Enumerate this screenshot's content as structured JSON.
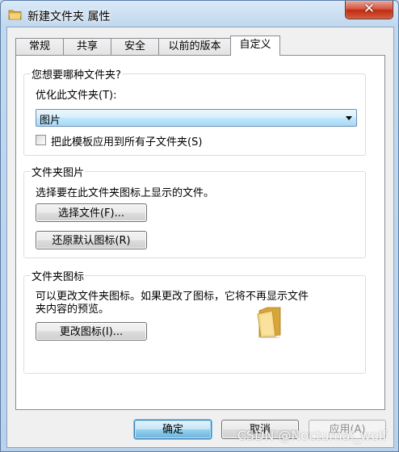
{
  "window": {
    "title": "新建文件夹 属性",
    "close_symbol": "✕"
  },
  "tabs": [
    {
      "label": "常规",
      "active": false
    },
    {
      "label": "共享",
      "active": false
    },
    {
      "label": "安全",
      "active": false
    },
    {
      "label": "以前的版本",
      "active": false
    },
    {
      "label": "自定义",
      "active": true
    }
  ],
  "folder_type_group": {
    "title": "您想要哪种文件夹?",
    "optimize_label": "优化此文件夹(T):",
    "optimize_value": "图片",
    "apply_subfolders_label": "把此模板应用到所有子文件夹(S)",
    "apply_subfolders_checked": false
  },
  "folder_pictures_group": {
    "title": "文件夹图片",
    "description": "选择要在此文件夹图标上显示的文件。",
    "choose_file_button": "选择文件(F)...",
    "restore_default_button": "还原默认图标(R)"
  },
  "folder_icons_group": {
    "title": "文件夹图标",
    "description_line1": "可以更改文件夹图标。如果更改了图标，它将不再显示文件",
    "description_line2": "夹内容的预览。",
    "change_icon_button": "更改图标(I)...",
    "icon": "folder-icon"
  },
  "footer": {
    "ok_button": "确定",
    "cancel_button": "取消",
    "apply_button": "应用(A)",
    "apply_disabled": true
  },
  "watermark": "CSDN @Nocturnal_wolf",
  "colors": {
    "title_bar": "#c1d8ee",
    "close_button": "#c8442b",
    "select_highlight": "#bee6fd",
    "default_button_border": "#3c7fb1"
  }
}
